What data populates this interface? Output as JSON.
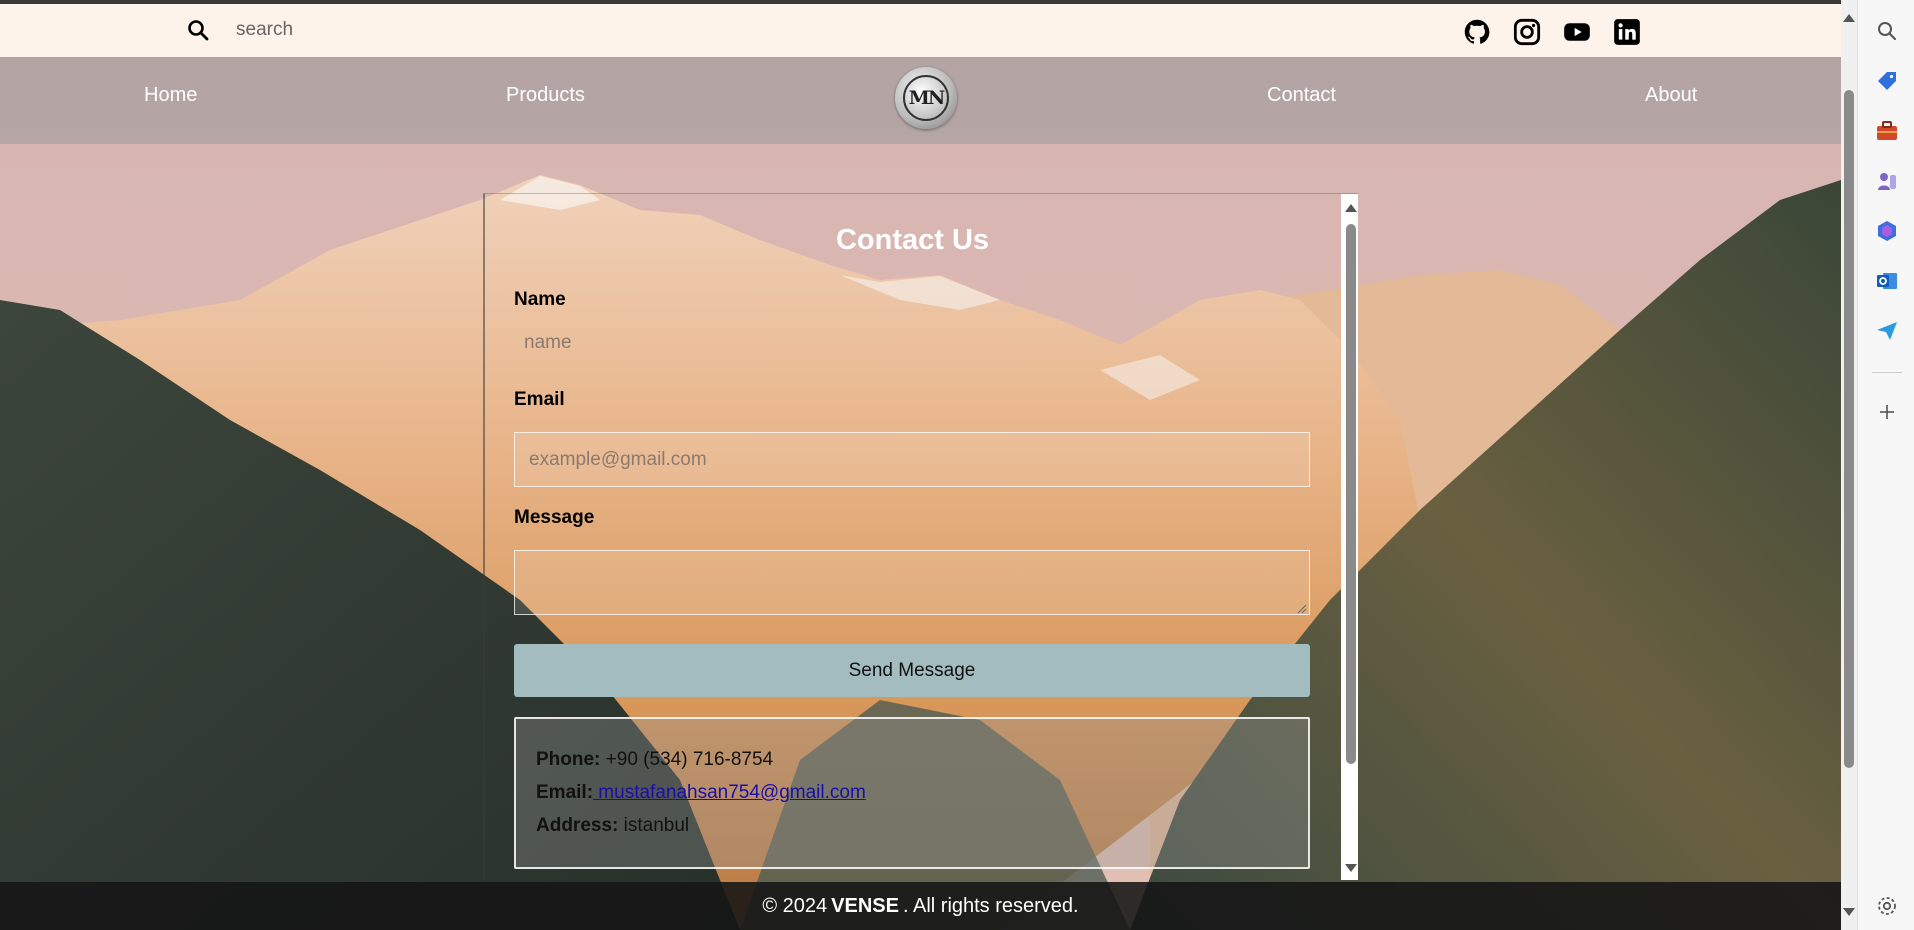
{
  "search": {
    "placeholder": "search"
  },
  "social_icons": [
    "github-icon",
    "instagram-icon",
    "youtube-icon",
    "linkedin-icon"
  ],
  "nav": {
    "items": [
      {
        "label": "Home"
      },
      {
        "label": "Products"
      },
      {
        "label": "Contact"
      },
      {
        "label": "About"
      }
    ],
    "logo_text": "MN"
  },
  "contact": {
    "title": "Contact Us",
    "name_label": "Name",
    "name_placeholder": "name",
    "email_label": "Email",
    "email_placeholder": "example@gmail.com",
    "message_label": "Message",
    "message_value": "",
    "send_label": "Send Message",
    "info": {
      "phone_label": "Phone:",
      "phone_value": "+90 (534) 716-8754",
      "email_label": "Email:",
      "email_value": " mustafanahsan754@gmail.com",
      "address_label": "Address:",
      "address_value": "istanbul"
    }
  },
  "footer": {
    "prefix": "© 2024",
    "brand": "VENSE",
    "suffix": ". All rights reserved."
  },
  "colors": {
    "topbar_bg": "#fdf3ea",
    "send_button": "#a3bcbf",
    "link": "#1a0dab"
  },
  "edge_sidebar_icons": [
    "search-icon",
    "tag-icon",
    "briefcase-icon",
    "games-icon",
    "copilot-icon",
    "outlook-icon",
    "send-icon",
    "add-icon",
    "settings-icon"
  ]
}
